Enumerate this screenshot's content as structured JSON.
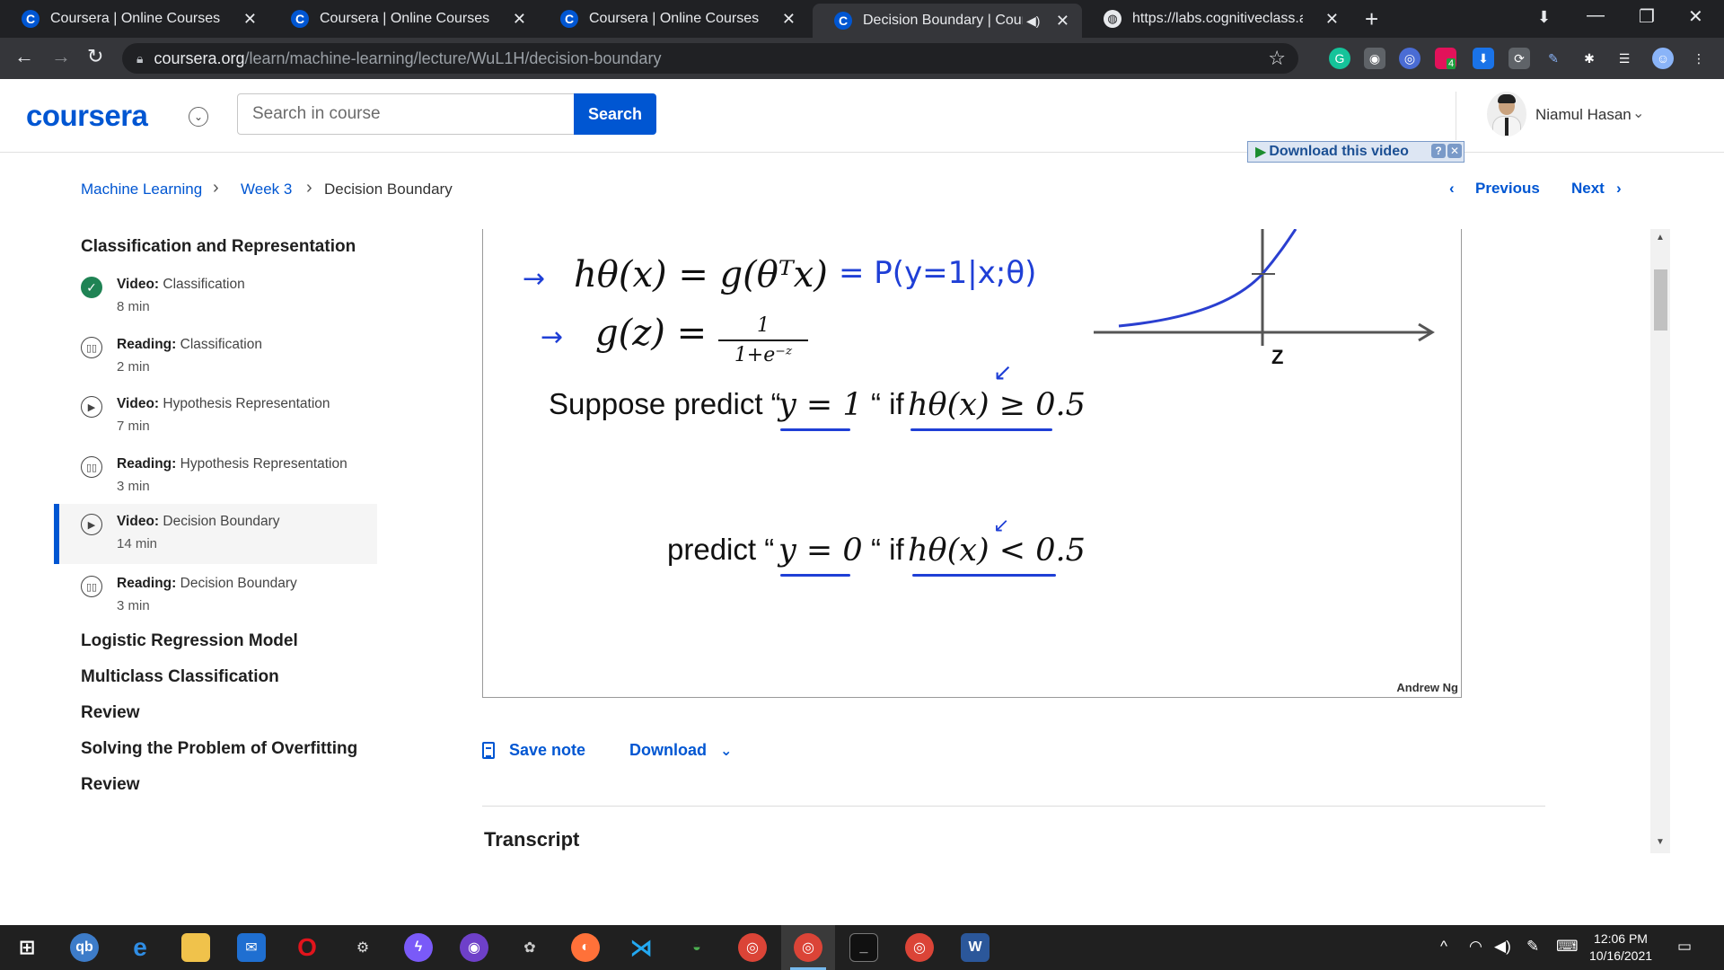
{
  "browser": {
    "tabs": [
      {
        "title": "Coursera | Online Courses & Credentials",
        "active": false
      },
      {
        "title": "Coursera | Online Courses & Credentials",
        "active": false
      },
      {
        "title": "Coursera | Online Courses & Credentials",
        "active": false
      },
      {
        "title": "Decision Boundary | Coursera",
        "active": true
      },
      {
        "title": "https://labs.cognitiveclass.ai/tools",
        "active": false
      }
    ],
    "url_host": "coursera.org",
    "url_path": "/learn/machine-learning/lecture/WuL1H/decision-boundary",
    "extension_badge": "4"
  },
  "header": {
    "logo": "coursera",
    "search_placeholder": "Search in course",
    "search_button": "Search",
    "user_name": "Niamul Hasan",
    "download_video": "Download this video"
  },
  "breadcrumb": {
    "course": "Machine Learning",
    "week": "Week 3",
    "current": "Decision Boundary"
  },
  "nav": {
    "previous": "Previous",
    "next": "Next"
  },
  "sidebar": {
    "section_title": "Classification and Representation",
    "items": [
      {
        "type": "Video:",
        "title": "Classification",
        "duration": "8 min",
        "status": "completed"
      },
      {
        "type": "Reading:",
        "title": "Classification",
        "duration": "2 min",
        "status": "reading"
      },
      {
        "type": "Video:",
        "title": "Hypothesis Representation",
        "duration": "7 min",
        "status": "video"
      },
      {
        "type": "Reading:",
        "title": "Hypothesis Representation",
        "duration": "3 min",
        "status": "reading"
      },
      {
        "type": "Video:",
        "title": "Decision Boundary",
        "duration": "14 min",
        "status": "active"
      },
      {
        "type": "Reading:",
        "title": "Decision Boundary",
        "duration": "3 min",
        "status": "reading"
      }
    ],
    "other_sections": [
      "Logistic Regression Model",
      "Multiclass Classification",
      "Review",
      "Solving the Problem of Overfitting",
      "Review"
    ]
  },
  "video": {
    "eq1_lhs": "hθ(x) = g(θᵀx)",
    "eq1_hand": "= P(y=1|x;θ)",
    "eq2_lhs": "g(z) =",
    "eq2_num": "1",
    "eq2_den": "1+e⁻ᶻ",
    "line1_text": "Suppose predict “",
    "line1_cond": "y = 1",
    "line1_if": "“ if",
    "line1_rhs": "hθ(x) ≥ 0.5",
    "line2_text": "predict “",
    "line2_cond": "y = 0",
    "line2_if": "“ if",
    "line2_rhs": "hθ(x) < 0.5",
    "axis_label": "Z",
    "signature": "Andrew Ng",
    "colors": {
      "ink": "#111111",
      "pen": "#1f3fd6"
    }
  },
  "actions": {
    "save_note": "Save note",
    "download": "Download"
  },
  "transcript_heading": "Transcript",
  "taskbar": {
    "time": "12:06 PM",
    "date": "10/16/2021"
  }
}
